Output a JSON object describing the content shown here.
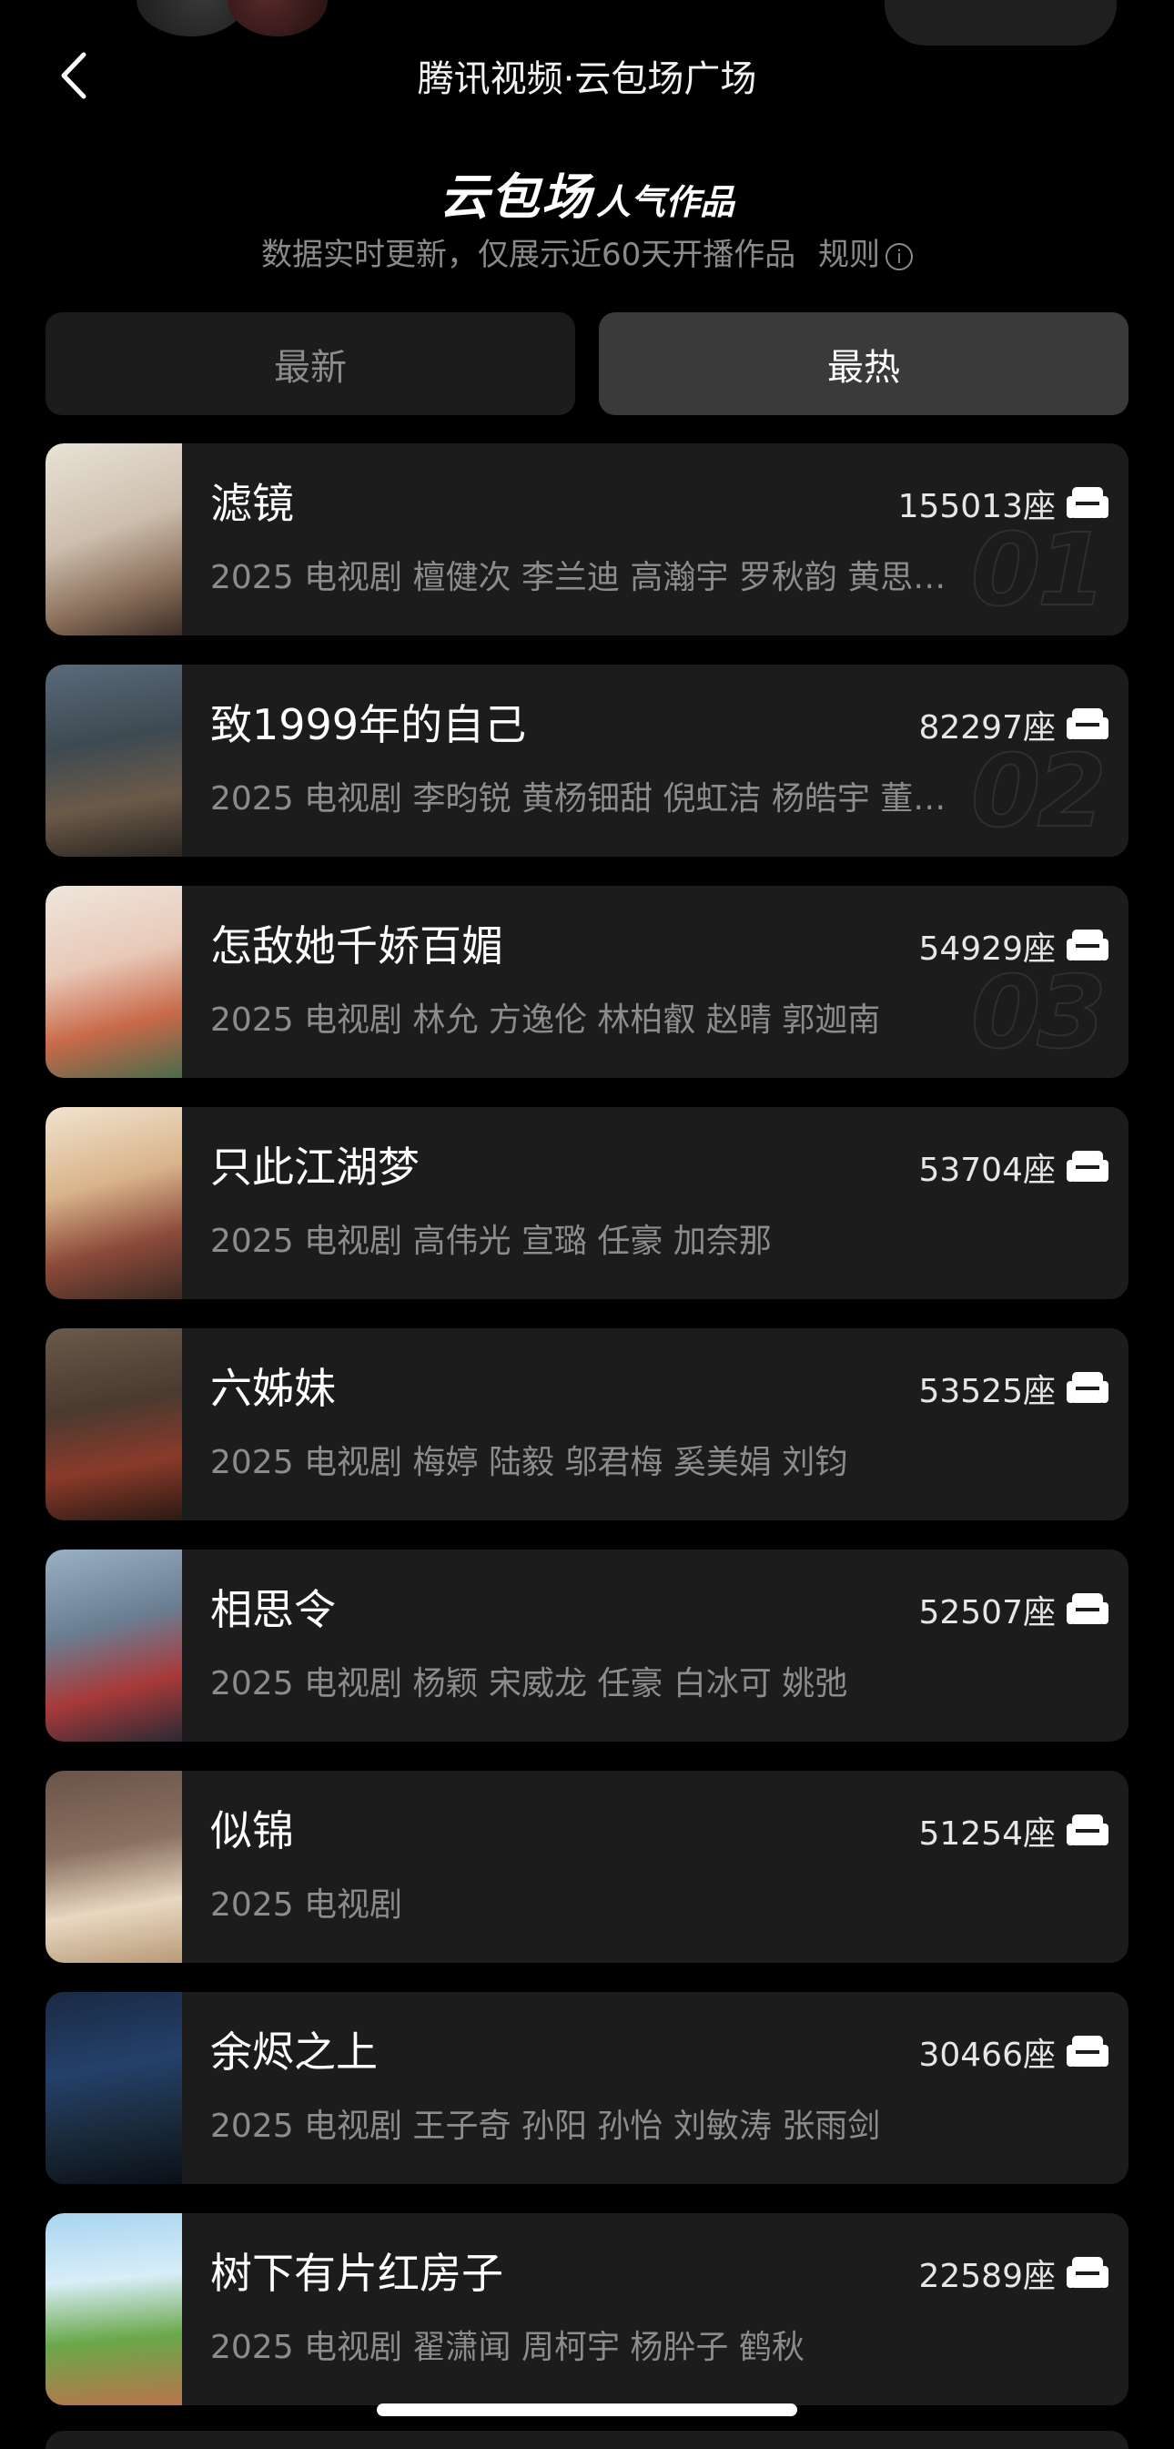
{
  "header": {
    "title": "腾讯视频·云包场广场"
  },
  "hero": {
    "title_big": "云包场",
    "title_small": "人气作品",
    "subtitle": "数据实时更新，仅展示近60天开播作品",
    "rules_label": "规则"
  },
  "tabs": [
    {
      "label": "最新",
      "active": false
    },
    {
      "label": "最热",
      "active": true
    }
  ],
  "items": [
    {
      "title": "滤镜",
      "seats": "155013座",
      "meta": "2025  电视剧  檀健次  李兰迪  高瀚宇  罗秋韵  黄思…",
      "rank": "01"
    },
    {
      "title": "致1999年的自己",
      "seats": "82297座",
      "meta": "2025  电视剧  李昀锐  黄杨钿甜  倪虹洁  杨皓宇  董…",
      "rank": "02"
    },
    {
      "title": "怎敌她千娇百媚",
      "seats": "54929座",
      "meta": "2025  电视剧  林允  方逸伦  林柏叡  赵晴  郭迦南",
      "rank": "03"
    },
    {
      "title": "只此江湖梦",
      "seats": "53704座",
      "meta": "2025  电视剧  高伟光  宣璐  任豪  加奈那",
      "rank": ""
    },
    {
      "title": "六姊妹",
      "seats": "53525座",
      "meta": "2025  电视剧  梅婷  陆毅  邬君梅  奚美娟  刘钧",
      "rank": ""
    },
    {
      "title": "相思令",
      "seats": "52507座",
      "meta": "2025  电视剧  杨颖  宋威龙  任豪  白冰可  姚弛",
      "rank": ""
    },
    {
      "title": "似锦",
      "seats": "51254座",
      "meta": "2025  电视剧",
      "rank": ""
    },
    {
      "title": "余烬之上",
      "seats": "30466座",
      "meta": "2025  电视剧  王子奇  孙阳  孙怡  刘敏涛  张雨剑",
      "rank": ""
    },
    {
      "title": "树下有片红房子",
      "seats": "22589座",
      "meta": "2025  电视剧  翟潇闻  周柯宇  杨肸子  鹤秋",
      "rank": ""
    }
  ],
  "colors": {
    "background": "#000000",
    "card": "#1c1c1c",
    "active_tab": "#3a3a3a",
    "muted_text": "#8c8c8c"
  }
}
